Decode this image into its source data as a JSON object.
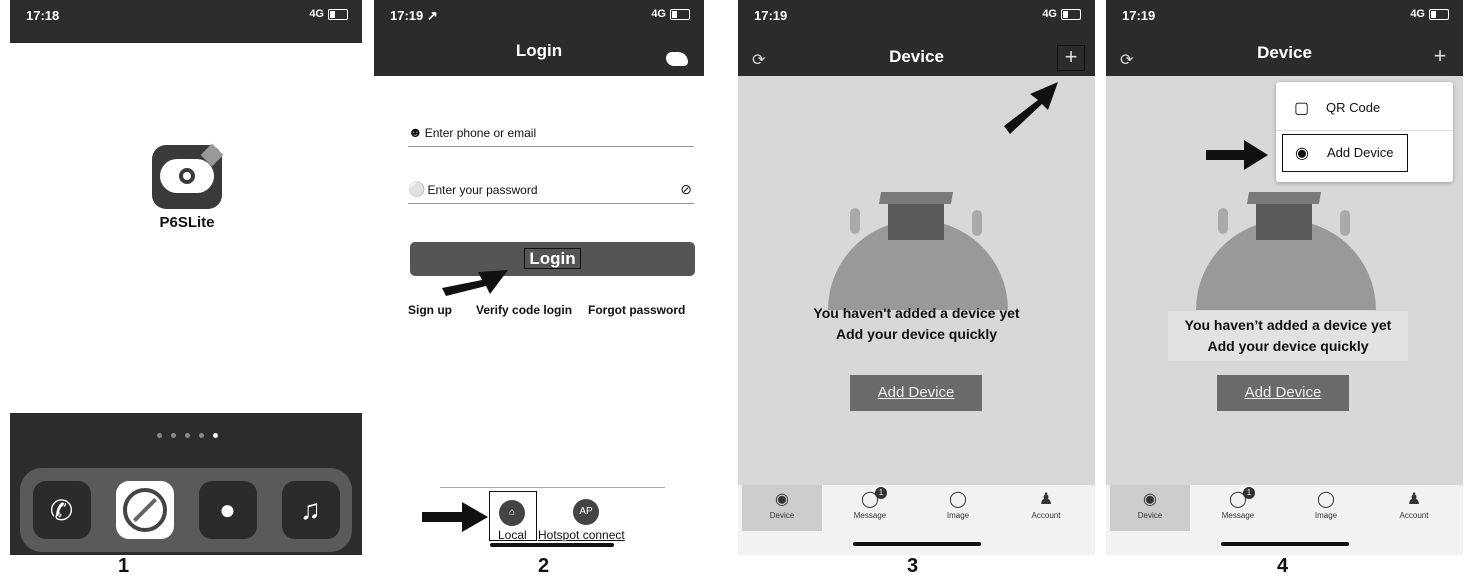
{
  "panel1": {
    "status": {
      "time": "17:18",
      "network": "4G"
    },
    "app_name": "P6SLite",
    "label": "1"
  },
  "panel2": {
    "status": {
      "time": "17:19 ↗",
      "network": "4G"
    },
    "title": "Login",
    "phone_placeholder": "Enter phone or email",
    "password_placeholder": "Enter your password",
    "login_label": "Login",
    "sign_up": "Sign up",
    "verify_code_login": "Verify code login",
    "forgot_password": "Forgot password",
    "local_label": "Local",
    "hotspot_label": "Hotspot connect",
    "ap_badge": "AP",
    "label": "2"
  },
  "panel3": {
    "status": {
      "time": "17:19",
      "network": "4G"
    },
    "title": "Device",
    "empty_line1": "You haven't added a device yet",
    "empty_line2": "Add your device quickly",
    "add_device": "Add Device",
    "tabs": [
      {
        "label": "Device"
      },
      {
        "label": "Message",
        "badge": "1"
      },
      {
        "label": "Image"
      },
      {
        "label": "Account"
      }
    ],
    "label": "3"
  },
  "panel4": {
    "status": {
      "time": "17:19",
      "network": "4G"
    },
    "title": "Device",
    "menu": {
      "qr_code": "QR Code",
      "add_device": "Add Device"
    },
    "empty_line1": "You haven’t added a device yet",
    "empty_line2": "Add your device quickly",
    "add_device": "Add Device",
    "tabs": [
      {
        "label": "Device"
      },
      {
        "label": "Message",
        "badge": "1"
      },
      {
        "label": "Image"
      },
      {
        "label": "Account"
      }
    ],
    "label": "4"
  }
}
